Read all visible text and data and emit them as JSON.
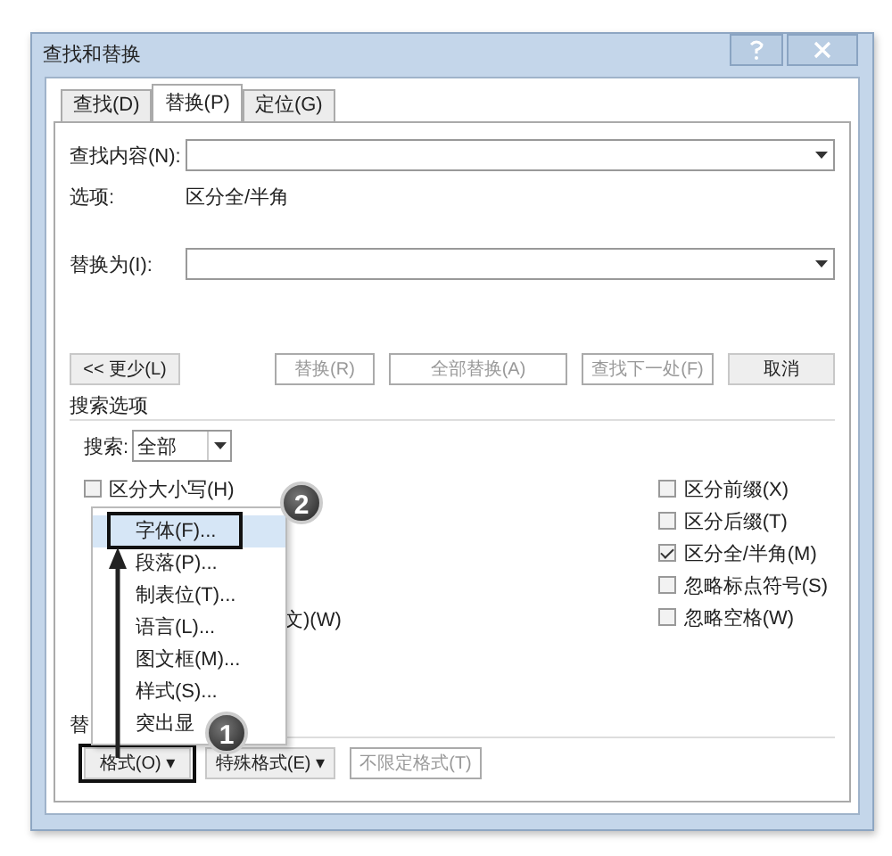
{
  "window": {
    "title": "查找和替换"
  },
  "tabs": [
    {
      "label": "查找(D)",
      "selected": false
    },
    {
      "label": "替换(P)",
      "selected": true
    },
    {
      "label": "定位(G)",
      "selected": false
    }
  ],
  "find": {
    "label": "查找内容(N):",
    "options_label": "选项:",
    "options_value": "区分全/半角"
  },
  "replace": {
    "label": "替换为(I):"
  },
  "buttons": [
    {
      "label": "<< 更少(L)",
      "disabled": false
    },
    {
      "label": "替换(R)",
      "disabled": true
    },
    {
      "label": "全部替换(A)",
      "disabled": true
    },
    {
      "label": "查找下一处(F)",
      "disabled": true
    },
    {
      "label": "取消",
      "disabled": false
    }
  ],
  "search_options": {
    "title": "搜索选项",
    "search_label": "搜索:",
    "search_value": "全部",
    "left": [
      {
        "kind": "checkbox",
        "label": "区分大小写(H)",
        "checked": false
      },
      {
        "kind": "fragment",
        "label": "文)(W)"
      }
    ],
    "right": [
      {
        "label": "区分前缀(X)",
        "checked": false
      },
      {
        "label": "区分后缀(T)",
        "checked": false
      },
      {
        "label": "区分全/半角(M)",
        "checked": true
      },
      {
        "label": "忽略标点符号(S)",
        "checked": false
      },
      {
        "label": "忽略空格(W)",
        "checked": false
      }
    ]
  },
  "replace_section": {
    "label": "替"
  },
  "bottom_buttons": [
    {
      "label": "格式(O) ▾",
      "disabled": false
    },
    {
      "label": "特殊格式(E) ▾",
      "disabled": false
    },
    {
      "label": "不限定格式(T)",
      "disabled": true
    }
  ],
  "menu": {
    "items": [
      {
        "label": "字体(F)...",
        "selected": true
      },
      {
        "label": "段落(P)...",
        "selected": false
      },
      {
        "label": "制表位(T)...",
        "selected": false
      },
      {
        "label": "语言(L)...",
        "selected": false
      },
      {
        "label": "图文框(M)...",
        "selected": false
      },
      {
        "label": "样式(S)...",
        "selected": false
      },
      {
        "label": "突出显",
        "selected": false
      }
    ]
  },
  "callouts": [
    "1",
    "2"
  ]
}
